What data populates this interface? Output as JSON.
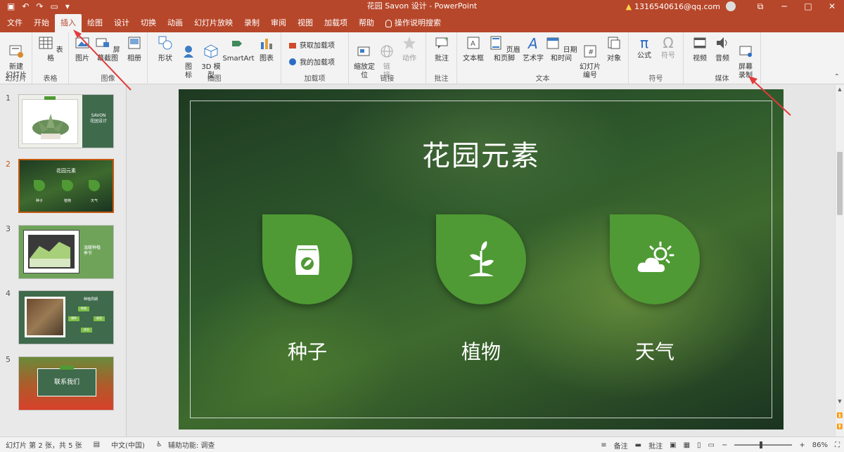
{
  "titlebar": {
    "doc_title": "花园 Savon 设计  -  PowerPoint",
    "account": "1316540616@qq.com",
    "window_buttons": [
      "─",
      "□",
      "✕"
    ]
  },
  "tabs": [
    {
      "label": "文件",
      "active": false
    },
    {
      "label": "开始",
      "active": false
    },
    {
      "label": "插入",
      "active": true
    },
    {
      "label": "绘图",
      "active": false
    },
    {
      "label": "设计",
      "active": false
    },
    {
      "label": "切换",
      "active": false
    },
    {
      "label": "动画",
      "active": false
    },
    {
      "label": "幻灯片放映",
      "active": false
    },
    {
      "label": "录制",
      "active": false
    },
    {
      "label": "审阅",
      "active": false
    },
    {
      "label": "视图",
      "active": false
    },
    {
      "label": "加载项",
      "active": false
    },
    {
      "label": "帮助",
      "active": false
    }
  ],
  "search_tab": "操作说明搜索",
  "ribbon": {
    "new_slide": "新建\n幻灯片",
    "group_slides": "幻灯片",
    "table": "表格",
    "group_table": "表格",
    "picture": "图片",
    "screenshot": "屏幕截图",
    "album": "相册",
    "group_images": "图像",
    "shapes": "形状",
    "icons": "图\n标",
    "model3d": "3D 模\n型",
    "smartart": "SmartArt",
    "chart": "图表",
    "group_illustrations": "插图",
    "get_addins": "获取加载项",
    "my_addins": "我的加载项",
    "group_addins": "加载项",
    "zoom": "缩放定\n位",
    "link": "链\n接",
    "action": "动作",
    "group_links": "链接",
    "comment": "批注",
    "group_comments": "批注",
    "textbox": "文本框",
    "header_footer": "页眉和页脚",
    "wordart": "艺术字",
    "datetime": "日期和时间",
    "slide_number": "幻灯片\n编号",
    "object": "对象",
    "group_text": "文本",
    "equation": "公式",
    "symbol": "符号",
    "group_symbols": "符号",
    "video": "视频",
    "audio": "音频",
    "screen_record": "屏幕\n录制",
    "group_media": "媒体"
  },
  "thumbnails": [
    {
      "num": "1",
      "title": "SAVON\n花园设计"
    },
    {
      "num": "2",
      "title": "花园元素",
      "labels": [
        "种子",
        "植物",
        "天气"
      ]
    },
    {
      "num": "3",
      "title": "温暖种植\n季节"
    },
    {
      "num": "4",
      "title": "种植周期",
      "labels": [
        "种植",
        "收获",
        "播种",
        "成长"
      ]
    },
    {
      "num": "5",
      "title": "联系我们"
    }
  ],
  "slide": {
    "title": "花园元素",
    "items": [
      {
        "label": "种子",
        "icon": "seed-bag-icon"
      },
      {
        "label": "植物",
        "icon": "sprout-icon"
      },
      {
        "label": "天气",
        "icon": "sun-cloud-icon"
      }
    ]
  },
  "status": {
    "slide_info": "幻灯片 第 2 张，共 5 张",
    "language": "中文(中国)",
    "accessibility": "辅助功能: 调查",
    "notes": "备注",
    "comments": "批注",
    "zoom": "86%"
  },
  "colors": {
    "accent": "#b7472a",
    "leaf_green": "#4f9a34",
    "annotation_red": "#e23b3b"
  }
}
